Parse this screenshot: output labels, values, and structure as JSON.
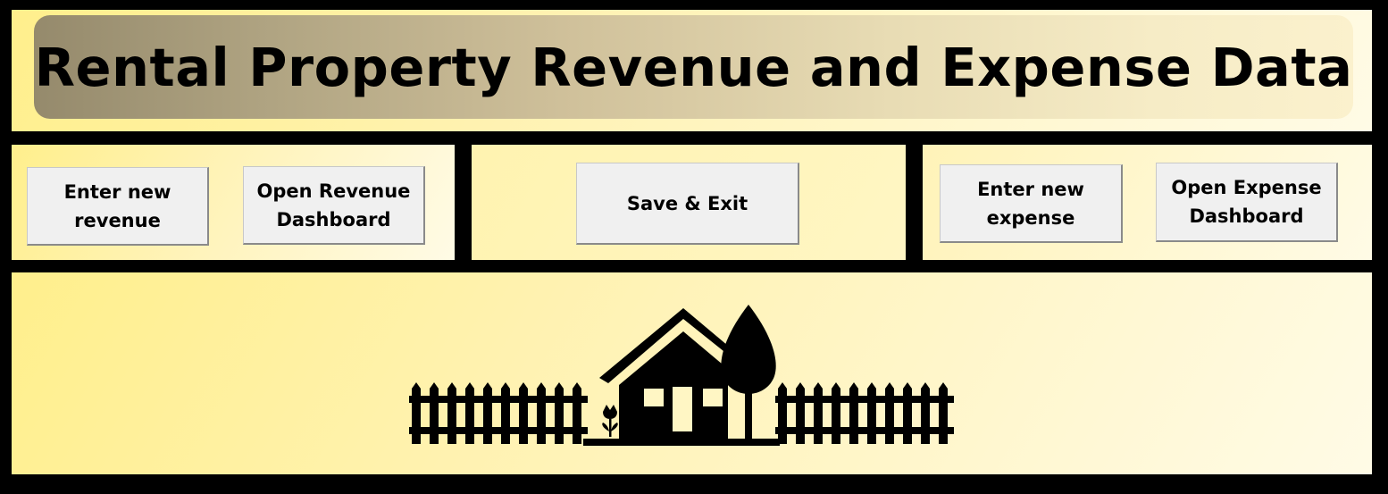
{
  "header": {
    "title": "Rental Property Revenue and Expense Data"
  },
  "revenue_panel": {
    "enter_new_line1": "Enter new",
    "enter_new_line2": "revenue",
    "open_dashboard_line1": "Open Revenue",
    "open_dashboard_line2": "Dashboard"
  },
  "center_panel": {
    "save_exit_label": "Save & Exit"
  },
  "expense_panel": {
    "enter_new_line1": "Enter new",
    "enter_new_line2": "expense",
    "open_dashboard_line1": "Open Expense",
    "open_dashboard_line2": "Dashboard"
  },
  "illustration": {
    "icon": "house-with-fence-and-tree-icon"
  },
  "colors": {
    "frame": "#000000",
    "panel_yellow": "#fff3b8",
    "button_face": "#f0f0f0",
    "banner_start": "#958a6c",
    "banner_end": "#fbf1cd"
  }
}
